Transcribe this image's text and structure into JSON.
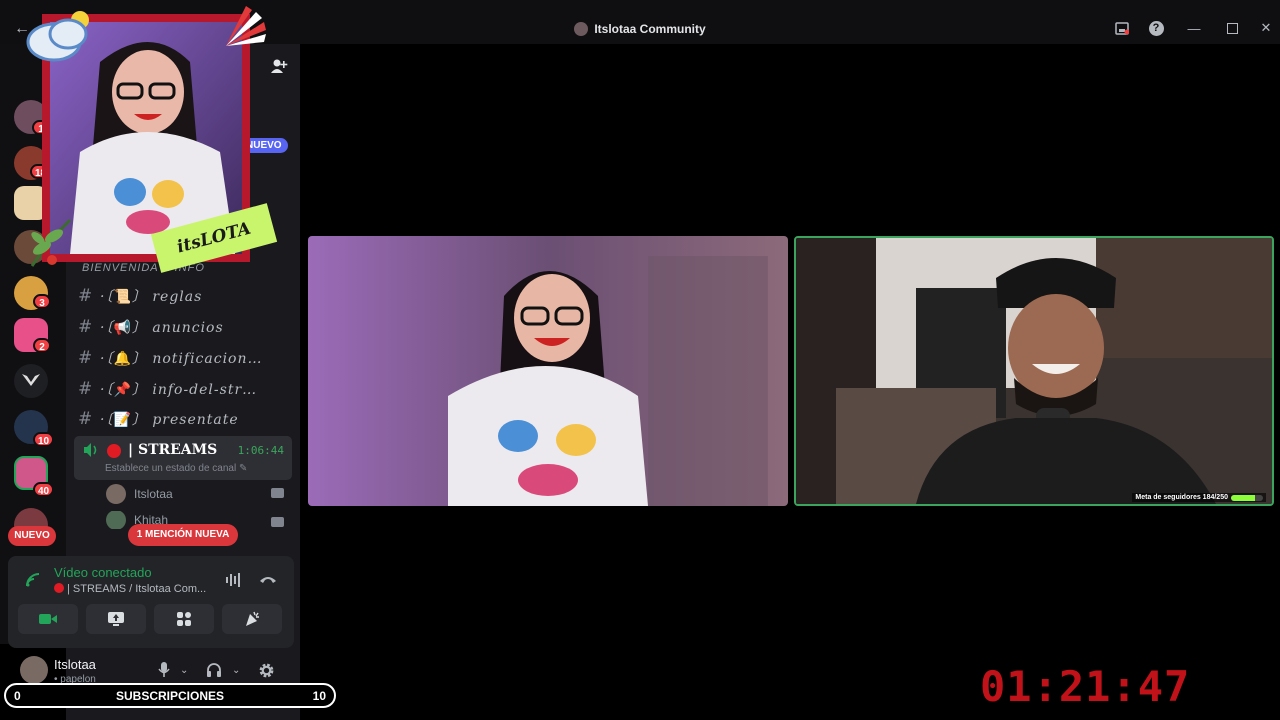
{
  "window": {
    "title": "Itslotaa Community"
  },
  "servers": {
    "badges": [
      "1",
      "18",
      "3",
      "2",
      "10",
      "40"
    ],
    "new_label": "NUEVO"
  },
  "channels": {
    "new_chip": "NUEVO",
    "category": "BIENVENIDA & INFO",
    "items": [
      {
        "prefix": "·〔",
        "glyph": "📜",
        "suffix": "〕",
        "name": "reglas"
      },
      {
        "prefix": "·〔",
        "glyph": "📢",
        "suffix": "〕",
        "name": "anuncios"
      },
      {
        "prefix": "·〔",
        "glyph": "🔔",
        "suffix": "〕",
        "name": "notificacion…"
      },
      {
        "prefix": "·〔",
        "glyph": "📌",
        "suffix": "〕",
        "name": "info-del-str…"
      },
      {
        "prefix": "·〔",
        "glyph": "📝",
        "suffix": "〕",
        "name": "presentate"
      }
    ],
    "voice": {
      "name": "| STREAMS",
      "elapsed": "1:06:44",
      "status": "Establece un estado de canal"
    },
    "voice_users": [
      "Itslotaa",
      "Khitah"
    ],
    "mention_pill": "1 MENCIÓN NUEVA"
  },
  "voice_panel": {
    "title": "Vídeo conectado",
    "subtitle": "| STREAMS / Itslotaa Com..."
  },
  "user": {
    "name": "Itslotaa",
    "status": "• papelon"
  },
  "subscriptions": {
    "label": "SUBSCRIPCIONES",
    "current": "0",
    "goal": "10"
  },
  "overlay": {
    "tape_text": "itsLOTA"
  },
  "tiles": {
    "follower_goal_label": "Meta de seguidores 184/250",
    "follower_progress": 0.736
  },
  "timer": "01:21:47",
  "colors": {
    "accent_green": "#23a559",
    "live_red": "#e01b24",
    "frame_red": "#b7182b",
    "tape_green": "#c9f56c",
    "timer_red": "#c1121a"
  }
}
